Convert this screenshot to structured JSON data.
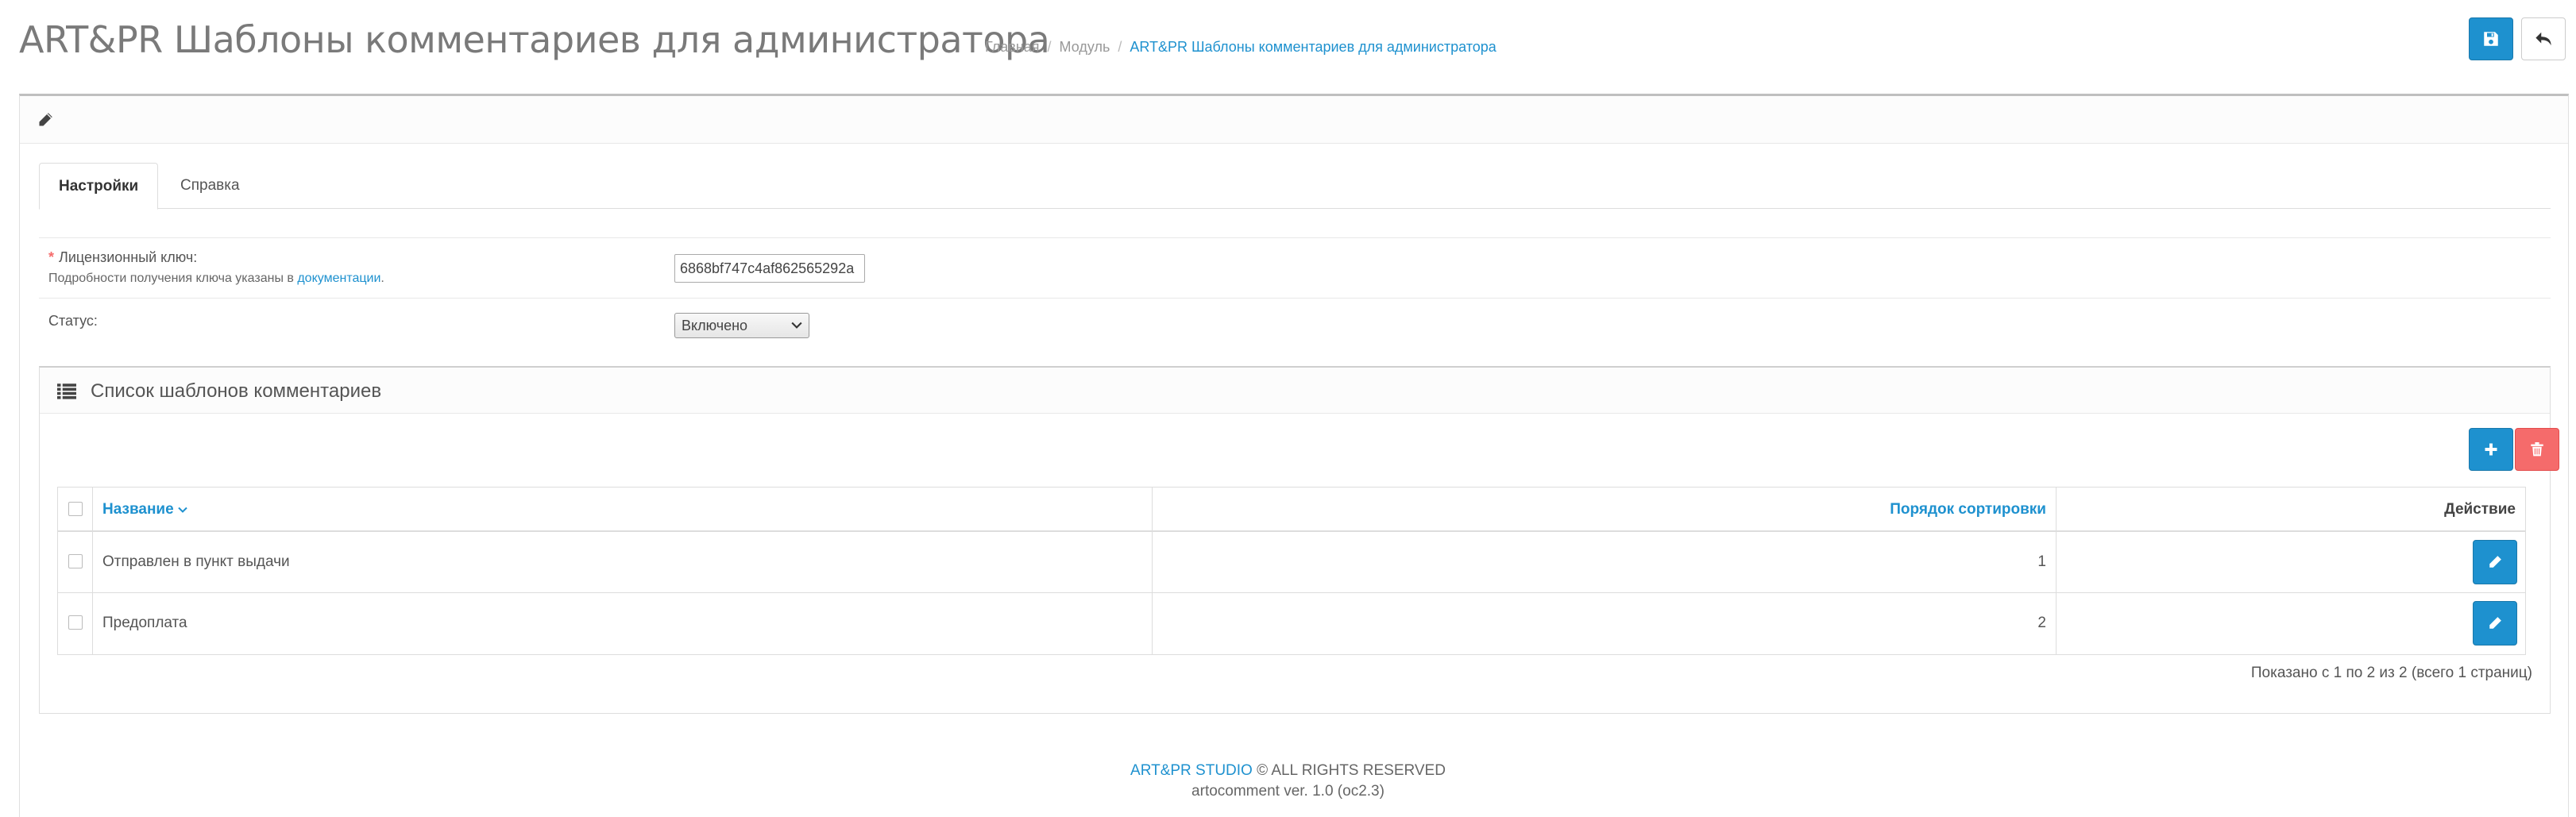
{
  "header": {
    "title": "ART&PR Шаблоны комментариев для администратора",
    "breadcrumb": [
      "Главная",
      "Модуль",
      "ART&PR Шаблоны комментариев для администратора"
    ],
    "save_icon": "floppy-disk-icon",
    "back_icon": "reply-arrow-icon"
  },
  "panel": {
    "heading_icon": "pencil-icon",
    "tabs": [
      {
        "label": "Настройки",
        "active": true
      },
      {
        "label": "Справка",
        "active": false
      }
    ]
  },
  "form": {
    "license": {
      "label": "Лицензионный ключ:",
      "help_prefix": "Подробности получения ключа указаны в",
      "help_link": "документации",
      "help_suffix": ".",
      "value": "6868bf747c4af862565292a"
    },
    "status": {
      "label": "Статус:",
      "value": "Включено"
    }
  },
  "list": {
    "title": "Список шаблонов комментариев",
    "columns": {
      "name": "Название",
      "sort_order": "Порядок сортировки",
      "action": "Действие"
    },
    "rows": [
      {
        "name": "Отправлен в пункт выдачи",
        "sort_order": "1"
      },
      {
        "name": "Предоплата",
        "sort_order": "2"
      }
    ],
    "pagination_info": "Показано с 1 по 2 из 2 (всего 1 страниц)"
  },
  "footer": {
    "brand": "ART&PR STUDIO",
    "rights": " © ALL RIGHTS RESERVED",
    "version": "artocomment ver. 1.0 (oc2.3)"
  },
  "colors": {
    "primary": "#1e91cf",
    "danger": "#f56b6b",
    "required": "#f56b6b"
  }
}
